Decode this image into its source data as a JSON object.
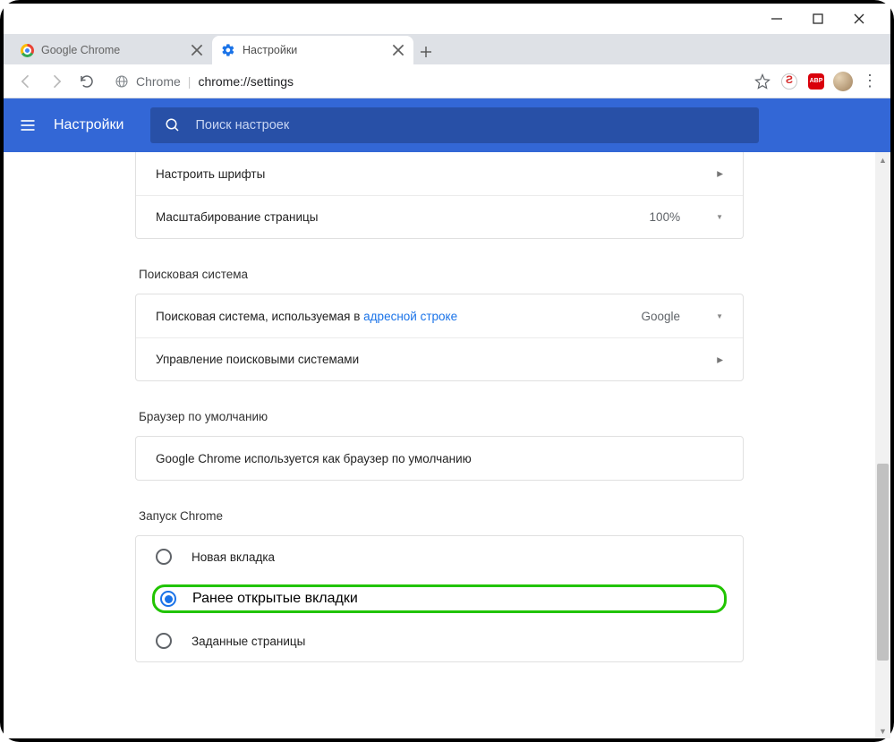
{
  "window": {
    "min": "−",
    "max": "☐",
    "close": "✕"
  },
  "tabs": [
    {
      "title": "Google Chrome",
      "active": false
    },
    {
      "title": "Настройки",
      "active": true
    }
  ],
  "omnibox": {
    "chip": "Chrome",
    "url": "chrome://settings"
  },
  "header": {
    "title": "Настройки"
  },
  "search": {
    "placeholder": "Поиск настроек"
  },
  "rows": {
    "fonts": "Настроить шрифты",
    "zoom_label": "Масштабирование страницы",
    "zoom_value": "100%"
  },
  "sections": {
    "search_engine": "Поисковая система",
    "default_browser": "Браузер по умолчанию",
    "startup": "Запуск Chrome"
  },
  "search_engine": {
    "label_prefix": "Поисковая система, используемая в ",
    "label_link": "адресной строке",
    "value": "Google",
    "manage": "Управление поисковыми системами"
  },
  "default_browser": {
    "text": "Google Chrome используется как браузер по умолчанию"
  },
  "startup_options": [
    {
      "label": "Новая вкладка",
      "checked": false
    },
    {
      "label": "Ранее открытые вкладки",
      "checked": true,
      "highlight": true
    },
    {
      "label": "Заданные страницы",
      "checked": false
    }
  ],
  "ext": {
    "abp": "ABP"
  }
}
